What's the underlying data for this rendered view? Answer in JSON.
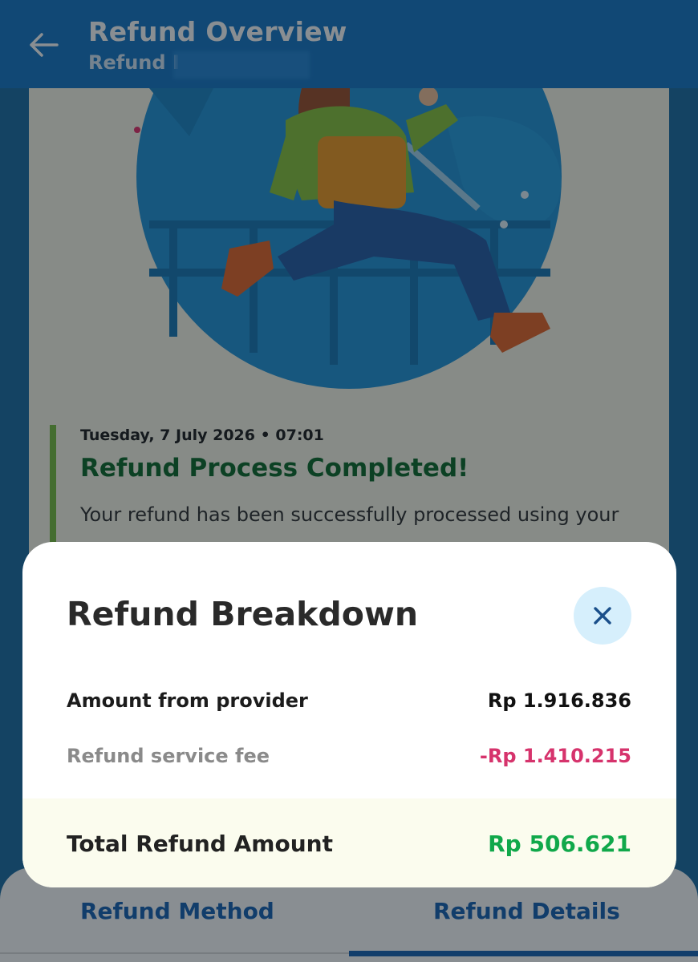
{
  "header": {
    "title": "Refund Overview",
    "subtitle": "Refund I"
  },
  "timeline": {
    "date": "Tuesday, 7 July 2026 • 07:01",
    "title": "Refund Process Completed!",
    "description": "Your refund has been successfully processed using your"
  },
  "tabs": [
    {
      "label": "Refund Method"
    },
    {
      "label": "Refund Details"
    }
  ],
  "active_tab": "Refund Details",
  "modal": {
    "title": "Refund Breakdown",
    "rows": [
      {
        "label": "Amount from provider",
        "value": "Rp 1.916.836"
      },
      {
        "label": "Refund service fee",
        "value": "-Rp 1.410.215"
      }
    ],
    "total": {
      "label": "Total Refund Amount",
      "value": "Rp 506.621"
    }
  },
  "icons": {
    "back": "arrow-left-icon",
    "close": "close-icon"
  },
  "colors": {
    "header_bg": "#1a7ac8",
    "fee_red": "#d6336c",
    "total_green": "#10a84a",
    "tab_blue": "#1a64b4",
    "close_bg": "#d6effc"
  }
}
